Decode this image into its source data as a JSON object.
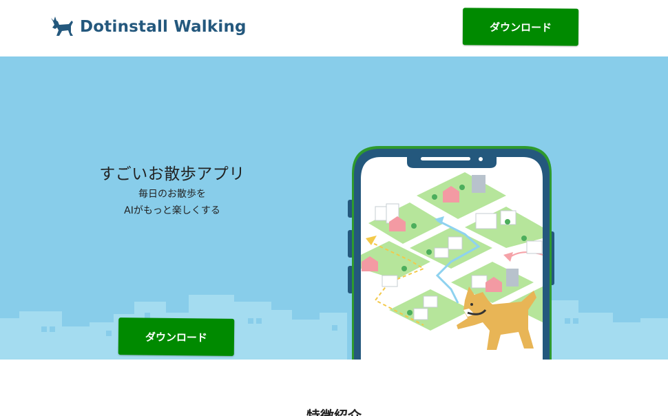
{
  "header": {
    "brand_name": "Dotinstall Walking",
    "logo_icon": "dog-silhouette-icon",
    "download_label": "ダウンロード"
  },
  "hero": {
    "title": "すごいお散歩アプリ",
    "subtitle_line1": "毎日のお散歩を",
    "subtitle_line2": "AIがもっと楽しくする",
    "download_label": "ダウンロード",
    "illustration": "phone-map-with-shiba-dog"
  },
  "features": {
    "heading": "特徴紹介"
  },
  "colors": {
    "brand_blue": "#24587d",
    "button_green": "#008a00",
    "hero_bg": "#88cdea",
    "skyline": "#a4dcf0",
    "phone_frame": "#24587d",
    "phone_border": "#2e9a2e"
  }
}
